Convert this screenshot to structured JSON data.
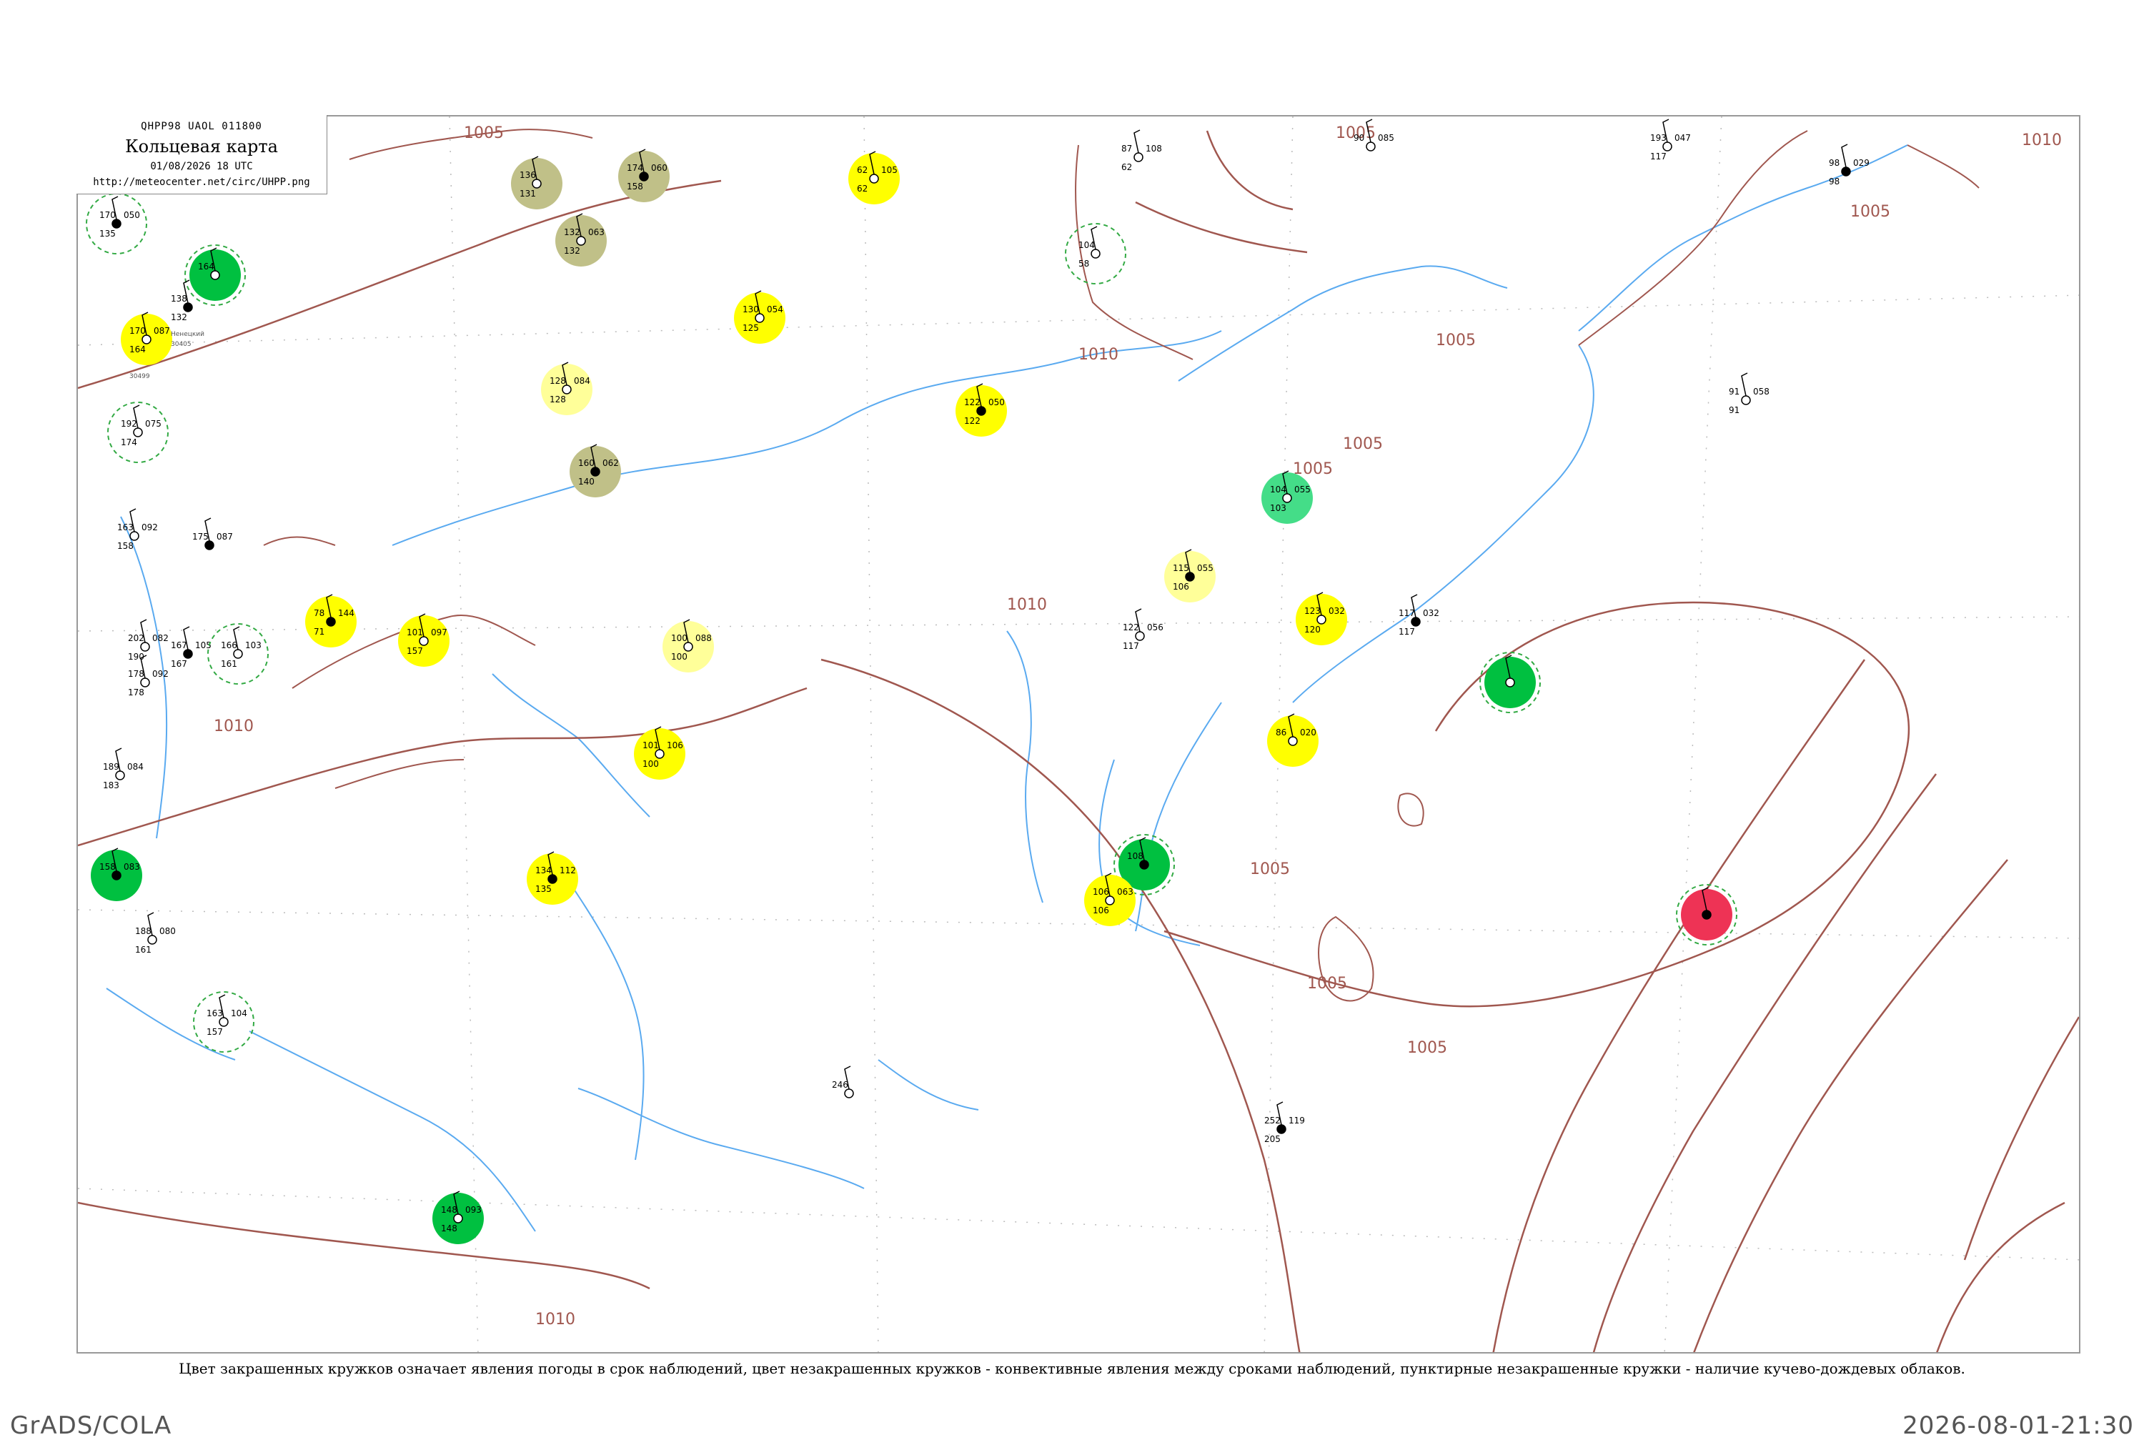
{
  "header": {
    "code": "QHPP98  UAOL  011800",
    "title": "Кольцевая карта",
    "datetime": "01/08/2026 18 UTC",
    "url": "http://meteocenter.net/circ/UHPP.png"
  },
  "caption": "Цвет закрашенных кружков означает явления погоды в срок наблюдений, цвет незакрашенных кружков - конвективные явления между сроками наблюдений, пунктирные незакрашенные кружки - наличие кучево-дождевых облаков.",
  "footer": {
    "left": "GrADS/COLA",
    "right": "2026-08-01-21:30"
  },
  "colors": {
    "isobar": "#a0574f",
    "water": "#5aaaf0",
    "grid": "#bbbbbb",
    "rain": "#ffff00",
    "shower": "#00c040",
    "drizzle": "#ffff99",
    "mist": "#c0c088",
    "teal": "#44dd88",
    "thunder": "#ee3355",
    "cb_ring": "#33aa44"
  },
  "isobar_labels": [
    "1005",
    "1010",
    "1005",
    "1005",
    "1010",
    "1005",
    "1010",
    "1005",
    "1010",
    "1005",
    "1005",
    "1010",
    "1005",
    "1005"
  ],
  "stations": [
    {
      "name": "",
      "code": "",
      "t": "170",
      "p": "050",
      "d": "135",
      "c": "",
      "ring": true
    },
    {
      "name": "",
      "code": "",
      "t": "164",
      "p": "",
      "d": "",
      "c": "shower",
      "ring": true
    },
    {
      "name": "",
      "code": "30499",
      "t": "170",
      "p": "087",
      "d": "164",
      "c": "rain"
    },
    {
      "name": "Ненецкий",
      "code": "30405",
      "t": "138",
      "p": "",
      "d": "132",
      "c": ""
    },
    {
      "name": "",
      "code": "",
      "t": "192",
      "p": "075",
      "d": "174",
      "c": "",
      "ring": true
    },
    {
      "name": "",
      "code": "",
      "t": "163",
      "p": "092",
      "d": "158",
      "c": ""
    },
    {
      "name": "",
      "code": "",
      "t": "175",
      "p": "087",
      "d": "",
      "c": ""
    },
    {
      "name": "",
      "code": "",
      "t": "202",
      "p": "082",
      "d": "190",
      "c": ""
    },
    {
      "name": "",
      "code": "",
      "t": "178",
      "p": "092",
      "d": "178",
      "c": ""
    },
    {
      "name": "",
      "code": "",
      "t": "167",
      "p": "105",
      "d": "167",
      "c": ""
    },
    {
      "name": "",
      "code": "",
      "t": "166",
      "p": "103",
      "d": "161",
      "c": "",
      "ring": true
    },
    {
      "name": "",
      "code": "",
      "t": "189",
      "p": "084",
      "d": "183",
      "c": ""
    },
    {
      "name": "",
      "code": "",
      "t": "158",
      "p": "083",
      "d": "",
      "c": "shower"
    },
    {
      "name": "",
      "code": "",
      "t": "188",
      "p": "080",
      "d": "161",
      "c": ""
    },
    {
      "name": "",
      "code": "",
      "t": "163",
      "p": "104",
      "d": "157",
      "c": "",
      "ring": true
    },
    {
      "name": "",
      "code": "",
      "t": "78",
      "p": "144",
      "d": "71",
      "c": "rain"
    },
    {
      "name": "",
      "code": "",
      "t": "101",
      "p": "097",
      "d": "157",
      "c": "rain"
    },
    {
      "name": "",
      "code": "",
      "t": "136",
      "p": "",
      "d": "131",
      "c": "mist"
    },
    {
      "name": "",
      "code": "",
      "t": "174",
      "p": "060",
      "d": "158",
      "c": "mist"
    },
    {
      "name": "",
      "code": "",
      "t": "132",
      "p": "063",
      "d": "132",
      "c": "mist"
    },
    {
      "name": "",
      "code": "",
      "t": "128",
      "p": "084",
      "d": "128",
      "c": "drizzle"
    },
    {
      "name": "",
      "code": "",
      "t": "160",
      "p": "062",
      "d": "140",
      "c": "mist"
    },
    {
      "name": "",
      "code": "",
      "t": "62",
      "p": "105",
      "d": "62",
      "c": "rain"
    },
    {
      "name": "",
      "code": "",
      "t": "130",
      "p": "054",
      "d": "125",
      "c": "rain"
    },
    {
      "name": "",
      "code": "",
      "t": "122",
      "p": "050",
      "d": "122",
      "c": "rain"
    },
    {
      "name": "",
      "code": "",
      "t": "100",
      "p": "088",
      "d": "100",
      "c": "drizzle"
    },
    {
      "name": "",
      "code": "",
      "t": "101",
      "p": "106",
      "d": "100",
      "c": "rain"
    },
    {
      "name": "",
      "code": "",
      "t": "134",
      "p": "112",
      "d": "135",
      "c": "rain"
    },
    {
      "name": "",
      "code": "",
      "t": "104",
      "p": "",
      "d": "58",
      "c": "",
      "ring": true
    },
    {
      "name": "",
      "code": "",
      "t": "104",
      "p": "055",
      "d": "103",
      "c": "teal"
    },
    {
      "name": "",
      "code": "",
      "t": "115",
      "p": "055",
      "d": "106",
      "c": "drizzle"
    },
    {
      "name": "",
      "code": "",
      "t": "123",
      "p": "032",
      "d": "120",
      "c": "rain"
    },
    {
      "name": "",
      "code": "",
      "t": "86",
      "p": "020",
      "d": "",
      "c": "rain"
    },
    {
      "name": "",
      "code": "",
      "t": "108",
      "p": "",
      "d": "",
      "c": "shower",
      "ring": true
    },
    {
      "name": "",
      "code": "",
      "t": "106",
      "p": "063",
      "d": "106",
      "c": "rain"
    },
    {
      "name": "",
      "code": "",
      "t": "",
      "p": "",
      "d": "",
      "c": "shower",
      "ring": true
    },
    {
      "name": "",
      "code": "",
      "t": "",
      "p": "",
      "d": "",
      "c": "thunder",
      "ring": true
    },
    {
      "name": "",
      "code": "",
      "t": "148",
      "p": "093",
      "d": "148",
      "c": "shower"
    },
    {
      "name": "",
      "code": "",
      "t": "193",
      "p": "047",
      "d": "117",
      "c": ""
    },
    {
      "name": "",
      "code": "",
      "t": "98",
      "p": "029",
      "d": "98",
      "c": ""
    },
    {
      "name": "",
      "code": "",
      "t": "87",
      "p": "108",
      "d": "62",
      "c": ""
    },
    {
      "name": "",
      "code": "",
      "t": "90",
      "p": "085",
      "d": "",
      "c": ""
    },
    {
      "name": "",
      "code": "",
      "t": "252",
      "p": "119",
      "d": "205",
      "c": ""
    },
    {
      "name": "",
      "code": "",
      "t": "246",
      "p": "",
      "d": "",
      "c": ""
    },
    {
      "name": "",
      "code": "",
      "t": "122",
      "p": "056",
      "d": "117",
      "c": ""
    },
    {
      "name": "",
      "code": "",
      "t": "117",
      "p": "032",
      "d": "117",
      "c": ""
    },
    {
      "name": "",
      "code": "",
      "t": "91",
      "p": "058",
      "d": "91",
      "c": ""
    }
  ]
}
